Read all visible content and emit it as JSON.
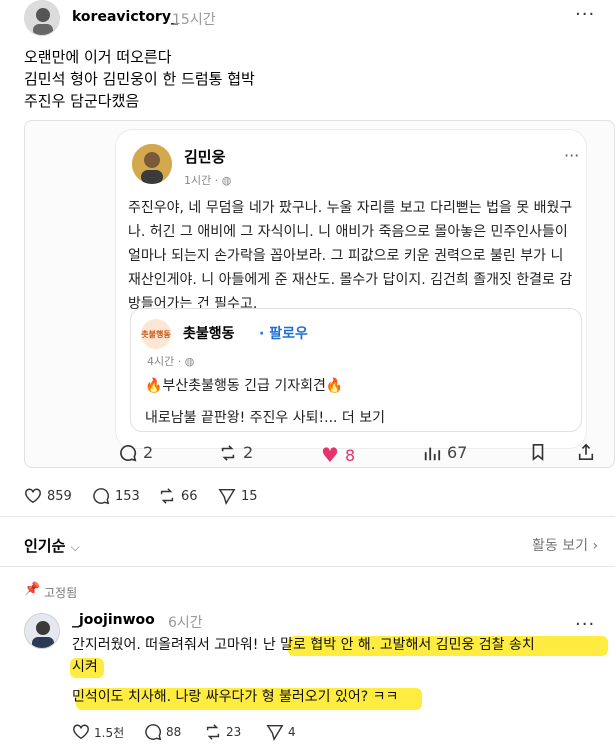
{
  "post": {
    "username": "koreavictory_",
    "time": "15시간",
    "more": "···",
    "lines": [
      "오랜만에 이거 떠오른다",
      "김민석 형아 김민웅이 한 드럼통 협박",
      "주진우 담군다캤음"
    ]
  },
  "embedded": {
    "name": "김민웅",
    "time": "1시간 · ",
    "more": "···",
    "text": "주진우야, 네 무덤을 네가 팠구나. 누울 자리를 보고 다리뻗는 법을 못 배웠구나. 허긴 그 애비에 그 자식이니. 니 애비가 죽음으로 몰아놓은 민주인사들이 얼마나 되는지 손가락을 꼽아보라. 그 피값으로 키운 권력으로 불린 부가 니 재산인게야. 니 아들에게 준 재산도. 몰수가 답이지. 김건희 졸개짓 한결로 감방들어가는 건 필수고.",
    "quote": {
      "avatar_text": "촛불행동",
      "name": "촛불행동",
      "follow": "· 팔로우",
      "time": "4시간 · ",
      "title": "🔥부산촛불행동 긴급 기자회견🔥",
      "sub": "내로남불 끝판왕! 주진우 사퇴!... 더 보기"
    },
    "actions": {
      "reply": "2",
      "repost": "2",
      "like": "8",
      "views": "67"
    }
  },
  "stats": {
    "likes": "859",
    "replies": "153",
    "reposts": "66",
    "shares": "15"
  },
  "sort": {
    "label": "인기순",
    "activity": "활동 보기"
  },
  "pinned_label": "고정됨",
  "reply": {
    "username": "_joojinwoo",
    "time": "6시간",
    "more": "···",
    "line1": "간지러웠어. 떠올려줘서 고마워! 난 말로 협박 안 해. 고발해서 김민웅 검찰 송치",
    "line2": "시켜",
    "line3": "민석이도 치사해. 나랑 싸우다가 형 불러오기 있어? ㅋㅋ",
    "stats": {
      "likes": "1.5천",
      "replies": "88",
      "reposts": "23",
      "shares": "4"
    }
  },
  "colors": {
    "heart": "#e8336d",
    "highlight": "#ffe600",
    "follow": "#1d6fd6"
  }
}
